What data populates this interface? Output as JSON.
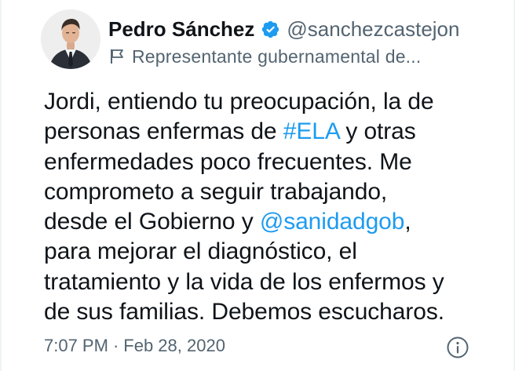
{
  "author": {
    "display_name": "Pedro Sánchez",
    "handle": "@sanchezcastejon",
    "label": "Representante gubernamental de...",
    "avatar_icon": "profile-photo",
    "verified_icon": "verified-badge-icon",
    "label_icon": "flag-icon"
  },
  "tweet": {
    "segments": [
      {
        "text": "Jordi, entiendo tu preocupación, la de"
      },
      {
        "text": "personas enfermas de "
      },
      {
        "text": "#ELA",
        "link": true
      },
      {
        "text": " y otras"
      },
      {
        "text": "enfermedades poco frecuentes. Me"
      },
      {
        "text": "comprometo a seguir trabajando,"
      },
      {
        "text": "desde el Gobierno y "
      },
      {
        "text": "@sanidadgob",
        "link": true
      },
      {
        "text": ","
      },
      {
        "text": "para mejorar el diagnóstico, el"
      },
      {
        "text": "tratamiento y la vida de los enfermos y"
      },
      {
        "text": "de sus familias. Debemos escucharos."
      }
    ]
  },
  "meta": {
    "time": "7:07 PM",
    "separator": "·",
    "date": "Feb 28, 2020",
    "info_icon": "info-icon"
  },
  "colors": {
    "link": "#1d9bf0",
    "secondary_text": "#536471",
    "primary_text": "#0f1419"
  }
}
